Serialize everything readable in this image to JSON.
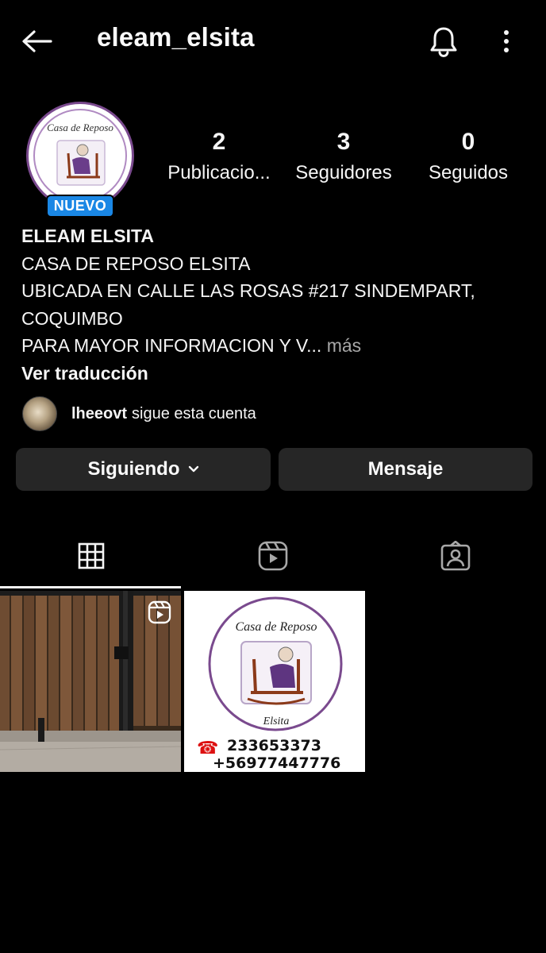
{
  "header": {
    "username": "eleam_elsita"
  },
  "profile": {
    "logo_text_top": "Casa de Reposo",
    "logo_text_bottom": "Elsita",
    "badge": "NUEVO",
    "stats": [
      {
        "value": "2",
        "label": "Publicacio..."
      },
      {
        "value": "3",
        "label": "Seguidores"
      },
      {
        "value": "0",
        "label": "Seguidos"
      }
    ],
    "display_name": "ELEAM ELSITA",
    "bio_lines": [
      "CASA DE REPOSO ELSITA",
      "UBICADA EN CALLE LAS ROSAS #217 SINDEMPART,",
      "COQUIMBO",
      "PARA MAYOR INFORMACION Y V..."
    ],
    "more_label": "más",
    "translate_label": "Ver traducción",
    "followed_by": {
      "user": "lheeovt",
      "text": "sigue esta cuenta"
    }
  },
  "actions": {
    "following_label": "Siguiendo",
    "message_label": "Mensaje"
  },
  "tabs": [
    {
      "icon": "grid-icon",
      "active": true
    },
    {
      "icon": "reels-icon",
      "active": false
    },
    {
      "icon": "tagged-icon",
      "active": false
    }
  ],
  "posts": [
    {
      "type": "reel",
      "description_icon": "reel-icon"
    },
    {
      "type": "image",
      "logo_text_top": "Casa de Reposo",
      "logo_text_bottom": "Elsita",
      "phone_1": "233653373",
      "phone_2": "+56977447776"
    }
  ],
  "colors": {
    "background": "#000000",
    "button": "#262626",
    "badge": "#1a87e5",
    "logo_ring": "#7a4a8e"
  }
}
